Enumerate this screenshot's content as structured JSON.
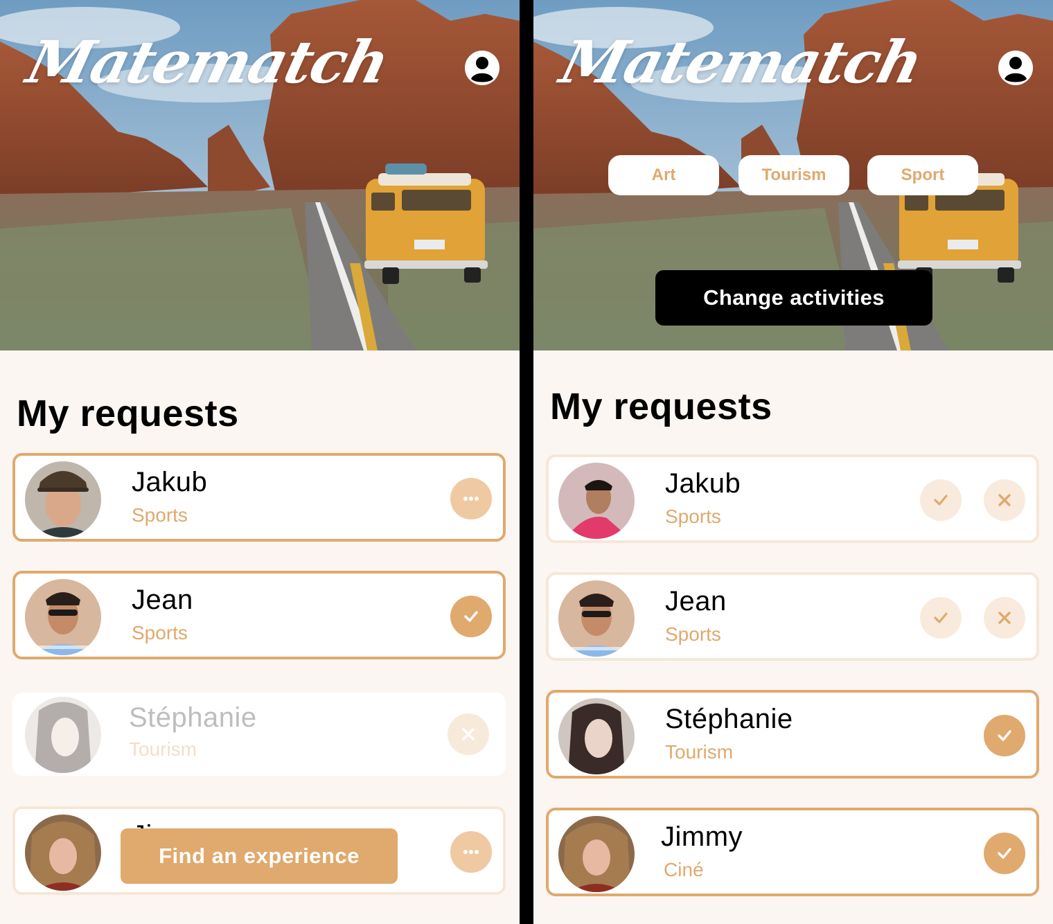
{
  "app": {
    "name": "Matematch"
  },
  "colors": {
    "accent": "#E0A96D",
    "accent_soft": "#F6E7D7",
    "background": "#FBF6F1",
    "dark": "#000000"
  },
  "screens": [
    {
      "title": "My requests",
      "requests": [
        {
          "name": "Jakub",
          "activity": "Sports",
          "action": "more-icon"
        },
        {
          "name": "Jean",
          "activity": "Sports",
          "action": "check-icon"
        },
        {
          "name": "Stéphanie",
          "activity": "Tourism",
          "action": "close-icon"
        },
        {
          "name": "Ji",
          "activity": "",
          "action": "more-icon"
        }
      ],
      "cta_label": "Find  an experience"
    },
    {
      "activities": [
        "Art",
        "Tourism",
        "Sport"
      ],
      "change_label": "Change activities",
      "title": "My requests",
      "requests": [
        {
          "name": "Jakub",
          "activity": "Sports",
          "action": "accept-decline"
        },
        {
          "name": "Jean",
          "activity": "Sports",
          "action": "accept-decline"
        },
        {
          "name": "Stéphanie",
          "activity": "Tourism",
          "action": "check-icon"
        },
        {
          "name": "Jimmy",
          "activity": "Ciné",
          "action": "check-icon"
        }
      ]
    }
  ]
}
